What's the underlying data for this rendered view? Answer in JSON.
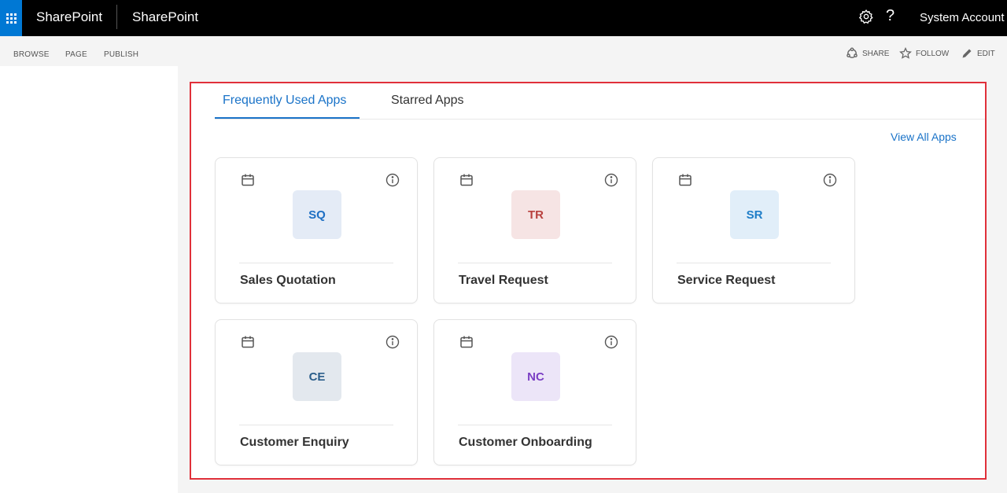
{
  "suite_bar": {
    "brand": "SharePoint",
    "site_title": "SharePoint",
    "icons": {
      "app_launcher": "waffle-icon",
      "settings": "gear-icon",
      "help": "help-icon"
    },
    "help_glyph": "?",
    "user": "System Account",
    "colors": {
      "background": "#000000",
      "launcher": "#0078d4"
    }
  },
  "ribbon": {
    "tabs": [
      "BROWSE",
      "PAGE",
      "PUBLISH"
    ],
    "actions": [
      {
        "label": "SHARE",
        "icon": "share-icon"
      },
      {
        "label": "FOLLOW",
        "icon": "star-icon"
      },
      {
        "label": "EDIT",
        "icon": "pencil-icon"
      }
    ]
  },
  "apps_panel": {
    "tabs": [
      {
        "label": "Frequently Used Apps",
        "active": true
      },
      {
        "label": "Starred Apps",
        "active": false
      }
    ],
    "view_all": "View All Apps",
    "highlight_border": "#e0303a",
    "accent": "#1a73c8",
    "cards": [
      {
        "code": "SQ",
        "name": "Sales Quotation",
        "tile_bg": "#e4ebf6",
        "tile_fg": "#1e6fc3"
      },
      {
        "code": "TR",
        "name": "Travel Request",
        "tile_bg": "#f6e4e4",
        "tile_fg": "#b8403e"
      },
      {
        "code": "SR",
        "name": "Service Request",
        "tile_bg": "#e1eef9",
        "tile_fg": "#1e7dc8"
      },
      {
        "code": "CE",
        "name": "Customer Enquiry",
        "tile_bg": "#e3e8ee",
        "tile_fg": "#2a5d8a"
      },
      {
        "code": "NC",
        "name": "Customer Onboarding",
        "tile_bg": "#ece5f8",
        "tile_fg": "#7b3fc4"
      }
    ],
    "card_icons": {
      "left": "calendar-icon",
      "right": "info-icon"
    }
  }
}
